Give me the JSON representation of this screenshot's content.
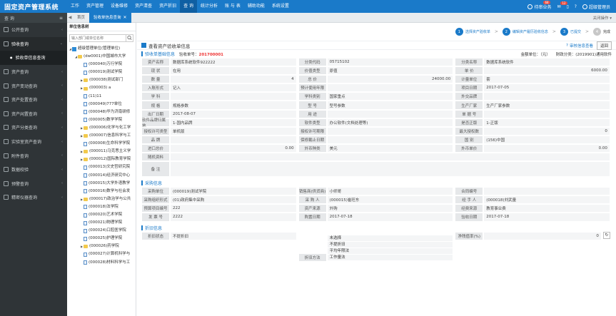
{
  "app": {
    "title": "固定资产管理系统",
    "nav": [
      "工作",
      "资产管理",
      "设备维修",
      "资产清查",
      "资产折旧",
      "查 询",
      "统计分析",
      "账 与 表",
      "辅助功能",
      "系统设置"
    ],
    "active_nav_index": 5,
    "right": {
      "tasks_label": "待审业务",
      "tasks_badge": "68",
      "msg_badge": "12",
      "user": "超级管理员"
    }
  },
  "sidebar": {
    "header_label": "查 询",
    "items": [
      {
        "label": "公开查询"
      },
      {
        "label": "验收查询",
        "open": true
      },
      {
        "label": "验收单信息查询",
        "sub": true
      },
      {
        "label": "资产查询"
      },
      {
        "label": "资产变动查询"
      },
      {
        "label": "资产处置查询"
      },
      {
        "label": "资产闲置查询"
      },
      {
        "label": "资产分类查询"
      },
      {
        "label": "实验室资产查询"
      },
      {
        "label": "附件查询"
      },
      {
        "label": "数据校验"
      },
      {
        "label": "预警查询"
      },
      {
        "label": "精密仪器查询"
      }
    ]
  },
  "tabs": {
    "home": "首页",
    "active": "验收单信息查询",
    "right_label": "关闭操作"
  },
  "tree": {
    "title": "单位信息树",
    "search_placeholder": "输入部门或单位名称",
    "nodes": [
      {
        "label": "超级管理单位(管理单位)",
        "type": "home",
        "indent": 0,
        "toggle": "◢"
      },
      {
        "label": "(dw0001)中国城市大学",
        "type": "folder",
        "indent": 1,
        "toggle": "◢"
      },
      {
        "label": "(000040)万行学院",
        "type": "doc",
        "indent": 2,
        "toggle": ""
      },
      {
        "label": "(000019)测试学院",
        "type": "doc",
        "indent": 2,
        "toggle": ""
      },
      {
        "label": "(000038)测试部门",
        "type": "folder",
        "indent": 2,
        "toggle": "▶"
      },
      {
        "label": "(000003) a",
        "type": "folder",
        "indent": 2,
        "toggle": "▶"
      },
      {
        "label": "(11)11",
        "type": "doc",
        "indent": 2,
        "toggle": ""
      },
      {
        "label": "(000049)777单位",
        "type": "doc",
        "indent": 2,
        "toggle": ""
      },
      {
        "label": "(000048)华为济南研修",
        "type": "doc",
        "indent": 2,
        "toggle": ""
      },
      {
        "label": "(000005)数学学院",
        "type": "doc",
        "indent": 2,
        "toggle": ""
      },
      {
        "label": "(000006)化学与化工学",
        "type": "folder",
        "indent": 2,
        "toggle": "▶"
      },
      {
        "label": "(000007)信息科学与工",
        "type": "folder",
        "indent": 2,
        "toggle": "▶"
      },
      {
        "label": "(000008)生命科学学院",
        "type": "doc",
        "indent": 2,
        "toggle": ""
      },
      {
        "label": "(000011)马克思主义学",
        "type": "folder",
        "indent": 2,
        "toggle": "▶"
      },
      {
        "label": "(000012)国际教育学院",
        "type": "folder",
        "indent": 2,
        "toggle": "▶"
      },
      {
        "label": "(000013)文史哲研究院",
        "type": "doc",
        "indent": 2,
        "toggle": ""
      },
      {
        "label": "(000014)经济研究中心",
        "type": "doc",
        "indent": 2,
        "toggle": ""
      },
      {
        "label": "(000015)大学外语教学",
        "type": "doc",
        "indent": 2,
        "toggle": ""
      },
      {
        "label": "(000016)数学与社会发",
        "type": "doc",
        "indent": 2,
        "toggle": ""
      },
      {
        "label": "(000017)政治学与公共",
        "type": "folder",
        "indent": 2,
        "toggle": "▶"
      },
      {
        "label": "(000018)法学院",
        "type": "doc",
        "indent": 2,
        "toggle": ""
      },
      {
        "label": "(000020)艺术学院",
        "type": "doc",
        "indent": 2,
        "toggle": ""
      },
      {
        "label": "(000021)物理学院",
        "type": "doc",
        "indent": 2,
        "toggle": ""
      },
      {
        "label": "(000024)口腔医学院",
        "type": "doc",
        "indent": 2,
        "toggle": ""
      },
      {
        "label": "(000025)护理学院",
        "type": "doc",
        "indent": 2,
        "toggle": ""
      },
      {
        "label": "(000026)药学院",
        "type": "folder",
        "indent": 2,
        "toggle": "▶"
      },
      {
        "label": "(000027)计算机科学与",
        "type": "doc",
        "indent": 2,
        "toggle": ""
      },
      {
        "label": "(000028)材料科学与工",
        "type": "doc",
        "indent": 2,
        "toggle": ""
      }
    ]
  },
  "steps": [
    {
      "num": "1",
      "label": "选择资产验收单",
      "done": false
    },
    {
      "num": "2",
      "label": "编辑资产履历验收信息",
      "done": false
    },
    {
      "num": "3",
      "label": "已提交",
      "done": false
    },
    {
      "num": "4",
      "label": "完成",
      "done": true
    }
  ],
  "page": {
    "title": "查看资产验收单信息",
    "audit_link": "审核信息查看",
    "back_btn": "返回"
  },
  "basic": {
    "section_title": "验收单基础信息",
    "doc_no_label": "验收单号：",
    "doc_no": "201700001",
    "unit_text": "金额单位：（元）",
    "finance_text": "财政分类：(2019901)通用软件",
    "rows": [
      [
        {
          "l": "资产名称",
          "v": "数据库系统软件922222"
        },
        {
          "l": "分类代码",
          "v": "05715102"
        },
        {
          "l": "分类名称",
          "v": "数据库系统软件"
        }
      ],
      [
        {
          "l": "现 状",
          "v": "在用"
        },
        {
          "l": "价值类型",
          "v": "原值"
        },
        {
          "l": "单 价",
          "v": "6000.00",
          "num": true
        }
      ],
      [
        {
          "l": "数 量",
          "v": "4",
          "num": true
        },
        {
          "l": "总 价",
          "v": "24000.00",
          "num": true
        },
        {
          "l": "计量单位",
          "v": "套"
        }
      ],
      [
        {
          "l": "入账形式",
          "v": "记入"
        },
        {
          "l": "预计使用年限",
          "v": ""
        },
        {
          "l": "项目日期",
          "v": "2017-07-05"
        }
      ],
      [
        {
          "l": "学 科",
          "v": ""
        },
        {
          "l": "学科类别",
          "v": "国家重点"
        },
        {
          "l": "外交品牌",
          "v": ""
        }
      ],
      [
        {
          "l": "规 格",
          "v": "规格参数"
        },
        {
          "l": "型 号",
          "v": "型号参数"
        },
        {
          "l": "生产厂家",
          "v": "生产厂家参数"
        }
      ],
      [
        {
          "l": "出厂日期",
          "v": "2017-08-07"
        },
        {
          "l": "用 途",
          "v": ""
        },
        {
          "l": "单 据 号",
          "v": ""
        }
      ],
      [
        {
          "l": "软件品牌归属地",
          "v": "1-国内品牌"
        },
        {
          "l": "软件类型",
          "v": "办公软件(文档处理等)"
        },
        {
          "l": "是否正版",
          "v": "1-正版"
        }
      ],
      [
        {
          "l": "授权许可类型",
          "v": "单机版"
        },
        {
          "l": "授权许可期限",
          "v": ""
        },
        {
          "l": "最大授权数",
          "v": "0",
          "num": true
        }
      ],
      [
        {
          "l": "品 牌",
          "v": ""
        },
        {
          "l": "保修截止日期",
          "v": ""
        },
        {
          "l": "国 别",
          "v": "(156)中国"
        }
      ],
      [
        {
          "l": "进口总价",
          "v": "0.00",
          "num": true
        },
        {
          "l": "外币种类",
          "v": "美元"
        },
        {
          "l": "外币单价",
          "v": "0.00",
          "num": true
        }
      ]
    ],
    "attach_label": "随机资料",
    "remark_label": "备 注"
  },
  "purchase": {
    "section_title": "采购信息",
    "rows": [
      [
        {
          "l": "采购单位",
          "v": "(000019)测试学院"
        },
        {
          "l": "销售商(供货商)",
          "v": "小师哥"
        },
        {
          "l": "合同编号",
          "v": ""
        }
      ],
      [
        {
          "l": "采购组织形式",
          "v": "(01)政府集中采购"
        },
        {
          "l": "采 购 人",
          "v": "(000015)崔旺东"
        },
        {
          "l": "经 手 人",
          "v": "(000018)刘武量"
        }
      ],
      [
        {
          "l": "预算项目编号",
          "v": "222"
        },
        {
          "l": "资产来源",
          "v": "外购"
        },
        {
          "l": "经费来源",
          "v": "教育事业费"
        }
      ],
      [
        {
          "l": "发 票 号",
          "v": "2222"
        },
        {
          "l": "购置日期",
          "v": "2017-07-18"
        },
        {
          "l": "验收日期",
          "v": "2017-07-18"
        }
      ]
    ]
  },
  "depreciation": {
    "section_title": "折旧信息",
    "status_label": "折旧状态",
    "status_value": "不提折旧",
    "method_label": "折旧方法",
    "methods": [
      "未选择",
      "不提折旧",
      "平均年限法",
      "工作量法"
    ],
    "rate_label": "净残值率(%)",
    "rate_value": "0"
  }
}
